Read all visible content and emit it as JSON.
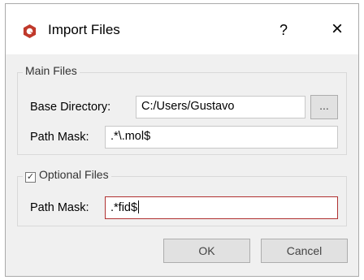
{
  "dialog": {
    "title": "Import Files",
    "help_label": "?",
    "close_label": "×"
  },
  "main_files": {
    "group_title": "Main Files",
    "base_directory_label": "Base Directory:",
    "base_directory_value": "C:/Users/Gustavo",
    "browse_label": "...",
    "path_mask_label": "Path Mask:",
    "path_mask_value": ".*\\.mol$"
  },
  "optional_files": {
    "group_title": "Optional Files",
    "checked": true,
    "checkmark": "✓",
    "path_mask_label": "Path Mask:",
    "path_mask_value": ".*fid$"
  },
  "buttons": {
    "ok_label": "OK",
    "cancel_label": "Cancel"
  },
  "colors": {
    "accent": "#b03030",
    "app_icon": "#c0392b"
  }
}
